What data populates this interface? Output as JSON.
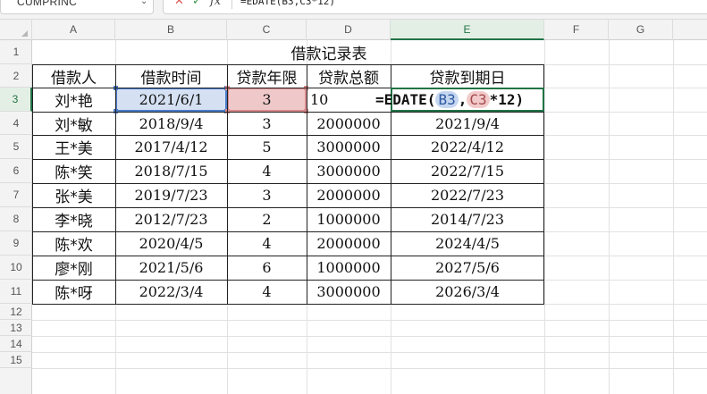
{
  "formula_bar": {
    "name_box": "CUMPRINC",
    "cancel_icon": "✕",
    "confirm_icon": "✓",
    "fx_label": "fx",
    "formula": "=EDATE(B3,C3*12)"
  },
  "columns": [
    "A",
    "B",
    "C",
    "D",
    "E",
    "F",
    "G"
  ],
  "rows": [
    "1",
    "2",
    "3",
    "4",
    "5",
    "6",
    "7",
    "8",
    "9",
    "10",
    "11",
    "12",
    "13",
    "14",
    "15"
  ],
  "sheet": {
    "title": "借款记录表",
    "headers": [
      "借款人",
      "借款时间",
      "贷款年限",
      "贷款总额",
      "贷款到期日"
    ],
    "records": [
      [
        "刘*艳",
        "2021/6/1",
        "3",
        "10",
        ""
      ],
      [
        "刘*敏",
        "2018/9/4",
        "3",
        "2000000",
        "2021/9/4"
      ],
      [
        "王*美",
        "2017/4/12",
        "5",
        "3000000",
        "2022/4/12"
      ],
      [
        "陈*笑",
        "2018/7/15",
        "4",
        "3000000",
        "2022/7/15"
      ],
      [
        "张*美",
        "2019/7/23",
        "3",
        "2000000",
        "2022/7/23"
      ],
      [
        "李*晓",
        "2012/7/23",
        "2",
        "1000000",
        "2014/7/23"
      ],
      [
        "陈*欢",
        "2020/4/5",
        "4",
        "2000000",
        "2024/4/5"
      ],
      [
        "廖*刚",
        "2021/5/6",
        "6",
        "1000000",
        "2027/5/6"
      ],
      [
        "陈*呀",
        "2022/3/4",
        "4",
        "3000000",
        "2026/3/4"
      ]
    ]
  },
  "editing": {
    "prefix": "=EDATE(",
    "ref1": "B3",
    "sep": ",",
    "ref2": "C3",
    "suffix": "*12)"
  },
  "colors": {
    "active_green": "#217346",
    "ref_blue": "#4a7cc9",
    "ref_red": "#d98a8c"
  }
}
